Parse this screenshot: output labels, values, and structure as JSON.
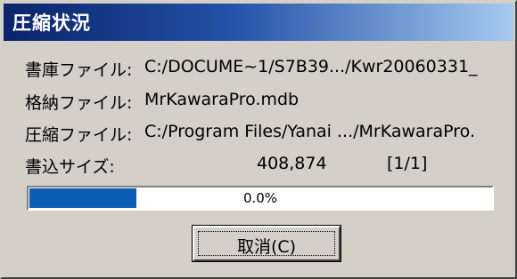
{
  "window": {
    "title": "圧縮状況"
  },
  "fields": {
    "archive": {
      "label": "書庫ファイル:",
      "value": "C:/DOCUME~1/S7B39.../Kwr20060331_"
    },
    "stored": {
      "label": "格納ファイル:",
      "value": "MrKawaraPro.mdb"
    },
    "compressing": {
      "label": "圧縮ファイル:",
      "value": "C:/Program Files/Yanai .../MrKawaraPro."
    },
    "written_size": {
      "label": "書込サイズ:",
      "value": "408,874",
      "counter": "[1/1]"
    }
  },
  "progress": {
    "percent_text": "0.0%",
    "fraction": 0.235,
    "fill_color": "#0a5fb4"
  },
  "buttons": {
    "cancel_label": "取消(C)"
  },
  "colors": {
    "titlebar_start": "#0a246a",
    "titlebar_end": "#a6caf0",
    "dialog_face": "#d4d0c8"
  }
}
